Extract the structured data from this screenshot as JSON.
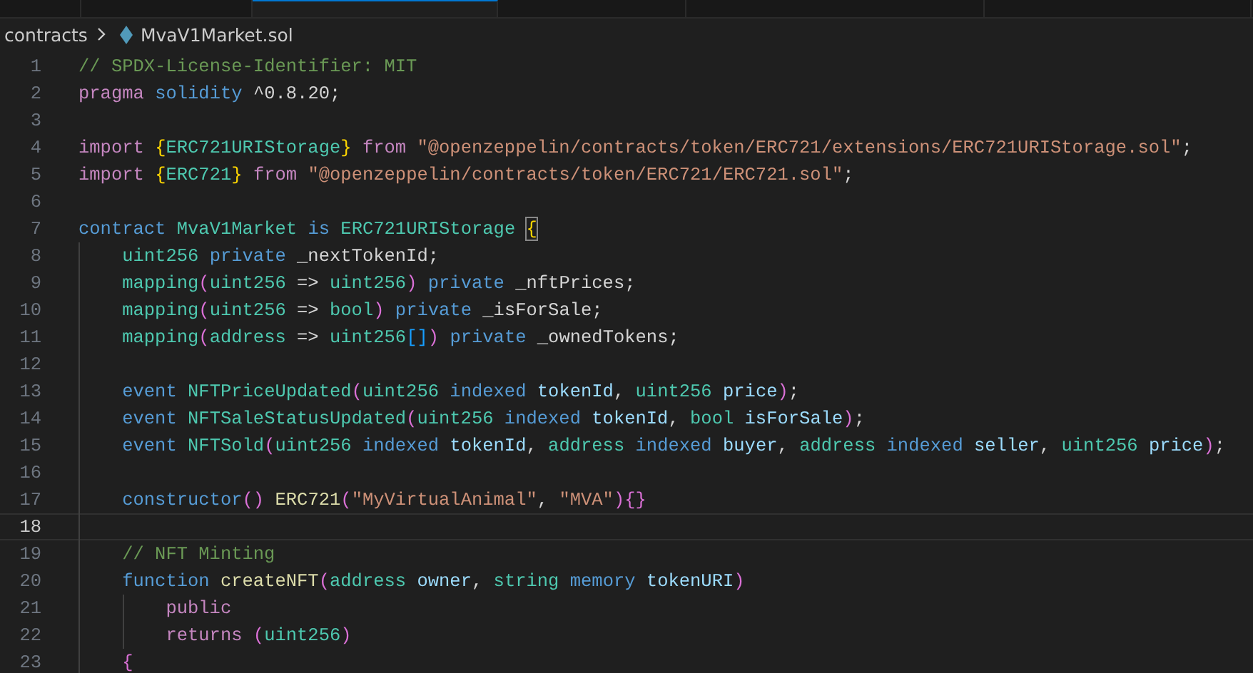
{
  "tabs": [
    {
      "selected": false
    },
    {
      "selected": false
    },
    {
      "selected": true
    },
    {
      "selected": false
    },
    {
      "selected": false
    },
    {
      "selected": false
    }
  ],
  "breadcrumb": {
    "folder": "contracts",
    "file": "MvaV1Market.sol"
  },
  "lines": [
    {
      "number": "1",
      "current": false,
      "tokens": [
        {
          "kind": "com",
          "text": "// SPDX-License-Identifier: MIT"
        }
      ]
    },
    {
      "number": "2",
      "current": false,
      "tokens": [
        {
          "kind": "kw",
          "text": "pragma "
        },
        {
          "kind": "st",
          "text": "solidity "
        },
        {
          "kind": "pl",
          "text": "^0.8.20;"
        }
      ]
    },
    {
      "number": "3",
      "current": false
    },
    {
      "number": "4",
      "current": false,
      "tokens": [
        {
          "kind": "kw",
          "text": "import "
        },
        {
          "kind": "b1",
          "text": "{"
        },
        {
          "kind": "ty",
          "text": "ERC721URIStorage"
        },
        {
          "kind": "b1",
          "text": "} "
        },
        {
          "kind": "kw",
          "text": "from "
        },
        {
          "kind": "str",
          "text": "\"@openzeppelin/contracts/token/ERC721/extensions/ERC721URIStorage.sol\""
        },
        {
          "kind": "pl",
          "text": ";"
        }
      ]
    },
    {
      "number": "5",
      "current": false,
      "tokens": [
        {
          "kind": "kw",
          "text": "import "
        },
        {
          "kind": "b1",
          "text": "{"
        },
        {
          "kind": "ty",
          "text": "ERC721"
        },
        {
          "kind": "b1",
          "text": "} "
        },
        {
          "kind": "kw",
          "text": "from "
        },
        {
          "kind": "str",
          "text": "\"@openzeppelin/contracts/token/ERC721/ERC721.sol\""
        },
        {
          "kind": "pl",
          "text": ";"
        }
      ]
    },
    {
      "number": "6",
      "current": false
    },
    {
      "number": "7",
      "current": false,
      "tokens": [
        {
          "kind": "st",
          "text": "contract "
        },
        {
          "kind": "ty",
          "text": "MvaV1Market "
        },
        {
          "kind": "st",
          "text": "is "
        },
        {
          "kind": "ty",
          "text": "ERC721URIStorage "
        },
        {
          "kind": "b1m",
          "text": "{"
        }
      ]
    },
    {
      "number": "8",
      "current": false,
      "tokens": [
        {
          "kind": "ind"
        },
        {
          "kind": "ty",
          "text": "uint256 "
        },
        {
          "kind": "st",
          "text": "private "
        },
        {
          "kind": "pl",
          "text": "_nextTokenId;"
        }
      ]
    },
    {
      "number": "9",
      "current": false,
      "tokens": [
        {
          "kind": "ind"
        },
        {
          "kind": "ty",
          "text": "mapping"
        },
        {
          "kind": "b2",
          "text": "("
        },
        {
          "kind": "ty",
          "text": "uint256 "
        },
        {
          "kind": "pl",
          "text": "=> "
        },
        {
          "kind": "ty",
          "text": "uint256"
        },
        {
          "kind": "b2",
          "text": ") "
        },
        {
          "kind": "st",
          "text": "private "
        },
        {
          "kind": "pl",
          "text": "_nftPrices;"
        }
      ]
    },
    {
      "number": "10",
      "current": false,
      "tokens": [
        {
          "kind": "ind"
        },
        {
          "kind": "ty",
          "text": "mapping"
        },
        {
          "kind": "b2",
          "text": "("
        },
        {
          "kind": "ty",
          "text": "uint256 "
        },
        {
          "kind": "pl",
          "text": "=> "
        },
        {
          "kind": "ty",
          "text": "bool"
        },
        {
          "kind": "b2",
          "text": ") "
        },
        {
          "kind": "st",
          "text": "private "
        },
        {
          "kind": "pl",
          "text": "_isForSale;"
        }
      ]
    },
    {
      "number": "11",
      "current": false,
      "tokens": [
        {
          "kind": "ind"
        },
        {
          "kind": "ty",
          "text": "mapping"
        },
        {
          "kind": "b2",
          "text": "("
        },
        {
          "kind": "ty",
          "text": "address "
        },
        {
          "kind": "pl",
          "text": "=> "
        },
        {
          "kind": "ty",
          "text": "uint256"
        },
        {
          "kind": "b3",
          "text": "[]"
        },
        {
          "kind": "b2",
          "text": ") "
        },
        {
          "kind": "st",
          "text": "private "
        },
        {
          "kind": "pl",
          "text": "_ownedTokens;"
        }
      ]
    },
    {
      "number": "12",
      "current": false,
      "tokens": [
        {
          "kind": "ind"
        }
      ]
    },
    {
      "number": "13",
      "current": false,
      "tokens": [
        {
          "kind": "ind"
        },
        {
          "kind": "st",
          "text": "event "
        },
        {
          "kind": "ty",
          "text": "NFTPriceUpdated"
        },
        {
          "kind": "b2",
          "text": "("
        },
        {
          "kind": "ty",
          "text": "uint256 "
        },
        {
          "kind": "st",
          "text": "indexed "
        },
        {
          "kind": "var",
          "text": "tokenId"
        },
        {
          "kind": "pl",
          "text": ", "
        },
        {
          "kind": "ty",
          "text": "uint256 "
        },
        {
          "kind": "var",
          "text": "price"
        },
        {
          "kind": "b2",
          "text": ")"
        },
        {
          "kind": "pl",
          "text": ";"
        }
      ]
    },
    {
      "number": "14",
      "current": false,
      "tokens": [
        {
          "kind": "ind"
        },
        {
          "kind": "st",
          "text": "event "
        },
        {
          "kind": "ty",
          "text": "NFTSaleStatusUpdated"
        },
        {
          "kind": "b2",
          "text": "("
        },
        {
          "kind": "ty",
          "text": "uint256 "
        },
        {
          "kind": "st",
          "text": "indexed "
        },
        {
          "kind": "var",
          "text": "tokenId"
        },
        {
          "kind": "pl",
          "text": ", "
        },
        {
          "kind": "ty",
          "text": "bool "
        },
        {
          "kind": "var",
          "text": "isForSale"
        },
        {
          "kind": "b2",
          "text": ")"
        },
        {
          "kind": "pl",
          "text": ";"
        }
      ]
    },
    {
      "number": "15",
      "current": false,
      "tokens": [
        {
          "kind": "ind"
        },
        {
          "kind": "st",
          "text": "event "
        },
        {
          "kind": "ty",
          "text": "NFTSold"
        },
        {
          "kind": "b2",
          "text": "("
        },
        {
          "kind": "ty",
          "text": "uint256 "
        },
        {
          "kind": "st",
          "text": "indexed "
        },
        {
          "kind": "var",
          "text": "tokenId"
        },
        {
          "kind": "pl",
          "text": ", "
        },
        {
          "kind": "ty",
          "text": "address "
        },
        {
          "kind": "st",
          "text": "indexed "
        },
        {
          "kind": "var",
          "text": "buyer"
        },
        {
          "kind": "pl",
          "text": ", "
        },
        {
          "kind": "ty",
          "text": "address "
        },
        {
          "kind": "st",
          "text": "indexed "
        },
        {
          "kind": "var",
          "text": "seller"
        },
        {
          "kind": "pl",
          "text": ", "
        },
        {
          "kind": "ty",
          "text": "uint256 "
        },
        {
          "kind": "var",
          "text": "price"
        },
        {
          "kind": "b2",
          "text": ")"
        },
        {
          "kind": "pl",
          "text": ";"
        }
      ]
    },
    {
      "number": "16",
      "current": false,
      "tokens": [
        {
          "kind": "ind"
        }
      ]
    },
    {
      "number": "17",
      "current": false,
      "tokens": [
        {
          "kind": "ind"
        },
        {
          "kind": "st",
          "text": "constructor"
        },
        {
          "kind": "b2",
          "text": "() "
        },
        {
          "kind": "fn",
          "text": "ERC721"
        },
        {
          "kind": "b2",
          "text": "("
        },
        {
          "kind": "str",
          "text": "\"MyVirtualAnimal\""
        },
        {
          "kind": "pl",
          "text": ", "
        },
        {
          "kind": "str",
          "text": "\"MVA\""
        },
        {
          "kind": "b2",
          "text": ")"
        },
        {
          "kind": "b2",
          "text": "{}"
        }
      ]
    },
    {
      "number": "18",
      "current": true,
      "tokens": [
        {
          "kind": "ind"
        }
      ]
    },
    {
      "number": "19",
      "current": false,
      "tokens": [
        {
          "kind": "ind"
        },
        {
          "kind": "com",
          "text": "// NFT Minting"
        }
      ]
    },
    {
      "number": "20",
      "current": false,
      "tokens": [
        {
          "kind": "ind"
        },
        {
          "kind": "st",
          "text": "function "
        },
        {
          "kind": "fn",
          "text": "createNFT"
        },
        {
          "kind": "b2",
          "text": "("
        },
        {
          "kind": "ty",
          "text": "address "
        },
        {
          "kind": "var",
          "text": "owner"
        },
        {
          "kind": "pl",
          "text": ", "
        },
        {
          "kind": "ty",
          "text": "string "
        },
        {
          "kind": "st",
          "text": "memory "
        },
        {
          "kind": "var",
          "text": "tokenURI"
        },
        {
          "kind": "b2",
          "text": ")"
        }
      ]
    },
    {
      "number": "21",
      "current": false,
      "tokens": [
        {
          "kind": "ind"
        },
        {
          "kind": "ind"
        },
        {
          "kind": "kw",
          "text": "public"
        }
      ]
    },
    {
      "number": "22",
      "current": false,
      "tokens": [
        {
          "kind": "ind"
        },
        {
          "kind": "ind"
        },
        {
          "kind": "kw",
          "text": "returns "
        },
        {
          "kind": "b2",
          "text": "("
        },
        {
          "kind": "ty",
          "text": "uint256"
        },
        {
          "kind": "b2",
          "text": ")"
        }
      ]
    },
    {
      "number": "23",
      "current": false,
      "tokens": [
        {
          "kind": "ind"
        },
        {
          "kind": "b2",
          "text": "{"
        }
      ]
    }
  ]
}
